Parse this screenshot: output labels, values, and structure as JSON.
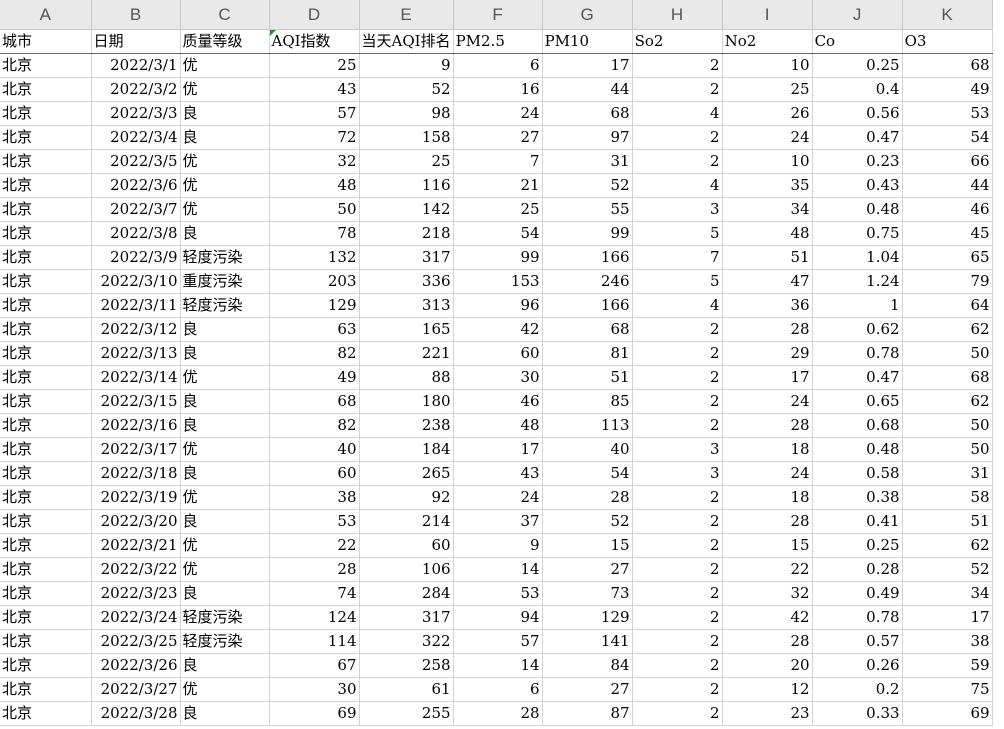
{
  "columns": [
    "A",
    "B",
    "C",
    "D",
    "E",
    "F",
    "G",
    "H",
    "I",
    "J",
    "K"
  ],
  "headers": [
    "城市",
    "日期",
    "质量等级",
    "AQI指数",
    "当天AQI排名",
    "PM2.5",
    "PM10",
    "So2",
    "No2",
    "Co",
    "O3"
  ],
  "rows": [
    [
      "北京",
      "2022/3/1",
      "优",
      "25",
      "9",
      "6",
      "17",
      "2",
      "10",
      "0.25",
      "68"
    ],
    [
      "北京",
      "2022/3/2",
      "优",
      "43",
      "52",
      "16",
      "44",
      "2",
      "25",
      "0.4",
      "49"
    ],
    [
      "北京",
      "2022/3/3",
      "良",
      "57",
      "98",
      "24",
      "68",
      "4",
      "26",
      "0.56",
      "53"
    ],
    [
      "北京",
      "2022/3/4",
      "良",
      "72",
      "158",
      "27",
      "97",
      "2",
      "24",
      "0.47",
      "54"
    ],
    [
      "北京",
      "2022/3/5",
      "优",
      "32",
      "25",
      "7",
      "31",
      "2",
      "10",
      "0.23",
      "66"
    ],
    [
      "北京",
      "2022/3/6",
      "优",
      "48",
      "116",
      "21",
      "52",
      "4",
      "35",
      "0.43",
      "44"
    ],
    [
      "北京",
      "2022/3/7",
      "优",
      "50",
      "142",
      "25",
      "55",
      "3",
      "34",
      "0.48",
      "46"
    ],
    [
      "北京",
      "2022/3/8",
      "良",
      "78",
      "218",
      "54",
      "99",
      "5",
      "48",
      "0.75",
      "45"
    ],
    [
      "北京",
      "2022/3/9",
      "轻度污染",
      "132",
      "317",
      "99",
      "166",
      "7",
      "51",
      "1.04",
      "65"
    ],
    [
      "北京",
      "2022/3/10",
      "重度污染",
      "203",
      "336",
      "153",
      "246",
      "5",
      "47",
      "1.24",
      "79"
    ],
    [
      "北京",
      "2022/3/11",
      "轻度污染",
      "129",
      "313",
      "96",
      "166",
      "4",
      "36",
      "1",
      "64"
    ],
    [
      "北京",
      "2022/3/12",
      "良",
      "63",
      "165",
      "42",
      "68",
      "2",
      "28",
      "0.62",
      "62"
    ],
    [
      "北京",
      "2022/3/13",
      "良",
      "82",
      "221",
      "60",
      "81",
      "2",
      "29",
      "0.78",
      "50"
    ],
    [
      "北京",
      "2022/3/14",
      "优",
      "49",
      "88",
      "30",
      "51",
      "2",
      "17",
      "0.47",
      "68"
    ],
    [
      "北京",
      "2022/3/15",
      "良",
      "68",
      "180",
      "46",
      "85",
      "2",
      "24",
      "0.65",
      "62"
    ],
    [
      "北京",
      "2022/3/16",
      "良",
      "82",
      "238",
      "48",
      "113",
      "2",
      "28",
      "0.68",
      "50"
    ],
    [
      "北京",
      "2022/3/17",
      "优",
      "40",
      "184",
      "17",
      "40",
      "3",
      "18",
      "0.48",
      "50"
    ],
    [
      "北京",
      "2022/3/18",
      "良",
      "60",
      "265",
      "43",
      "54",
      "3",
      "24",
      "0.58",
      "31"
    ],
    [
      "北京",
      "2022/3/19",
      "优",
      "38",
      "92",
      "24",
      "28",
      "2",
      "18",
      "0.38",
      "58"
    ],
    [
      "北京",
      "2022/3/20",
      "良",
      "53",
      "214",
      "37",
      "52",
      "2",
      "28",
      "0.41",
      "51"
    ],
    [
      "北京",
      "2022/3/21",
      "优",
      "22",
      "60",
      "9",
      "15",
      "2",
      "15",
      "0.25",
      "62"
    ],
    [
      "北京",
      "2022/3/22",
      "优",
      "28",
      "106",
      "14",
      "27",
      "2",
      "22",
      "0.28",
      "52"
    ],
    [
      "北京",
      "2022/3/23",
      "良",
      "74",
      "284",
      "53",
      "73",
      "2",
      "32",
      "0.49",
      "34"
    ],
    [
      "北京",
      "2022/3/24",
      "轻度污染",
      "124",
      "317",
      "94",
      "129",
      "2",
      "42",
      "0.78",
      "17"
    ],
    [
      "北京",
      "2022/3/25",
      "轻度污染",
      "114",
      "322",
      "57",
      "141",
      "2",
      "28",
      "0.57",
      "38"
    ],
    [
      "北京",
      "2022/3/26",
      "良",
      "67",
      "258",
      "14",
      "84",
      "2",
      "20",
      "0.26",
      "59"
    ],
    [
      "北京",
      "2022/3/27",
      "优",
      "30",
      "61",
      "6",
      "27",
      "2",
      "12",
      "0.2",
      "75"
    ],
    [
      "北京",
      "2022/3/28",
      "良",
      "69",
      "255",
      "28",
      "87",
      "2",
      "23",
      "0.33",
      "69"
    ]
  ]
}
